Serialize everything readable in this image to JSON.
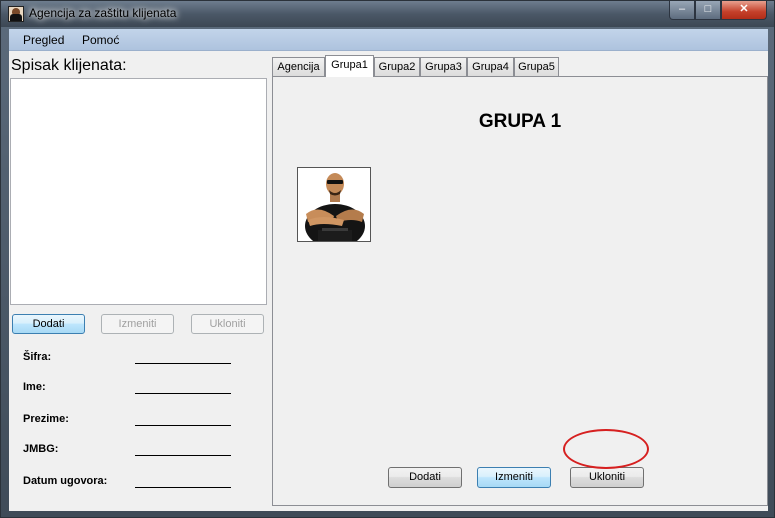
{
  "window": {
    "title": "Agencija za zaštitu klijenata",
    "controls": {
      "minimize": "–",
      "maximize": "□",
      "close": "✕"
    }
  },
  "menu": {
    "items": [
      "Pregled",
      "Pomoć"
    ]
  },
  "left_panel": {
    "list_title": "Spisak klijenata:",
    "buttons": {
      "add": "Dodati",
      "edit": "Izmeniti",
      "remove": "Ukloniti"
    },
    "fields": [
      "Šifra:",
      "Ime:",
      "Prezime:",
      "JMBG:",
      "Datum ugovora:"
    ]
  },
  "tabs": {
    "labels": [
      "Agencija",
      "Grupa1",
      "Grupa2",
      "Grupa3",
      "Grupa4",
      "Grupa5"
    ],
    "active": "Grupa1"
  },
  "group_page": {
    "title": "GRUPA 1",
    "buttons": {
      "add": "Dodati",
      "edit": "Izmeniti",
      "remove": "Ukloniti"
    }
  },
  "colors": {
    "highlight_circle": "#d62020",
    "menubar": "#b8cbe4"
  }
}
